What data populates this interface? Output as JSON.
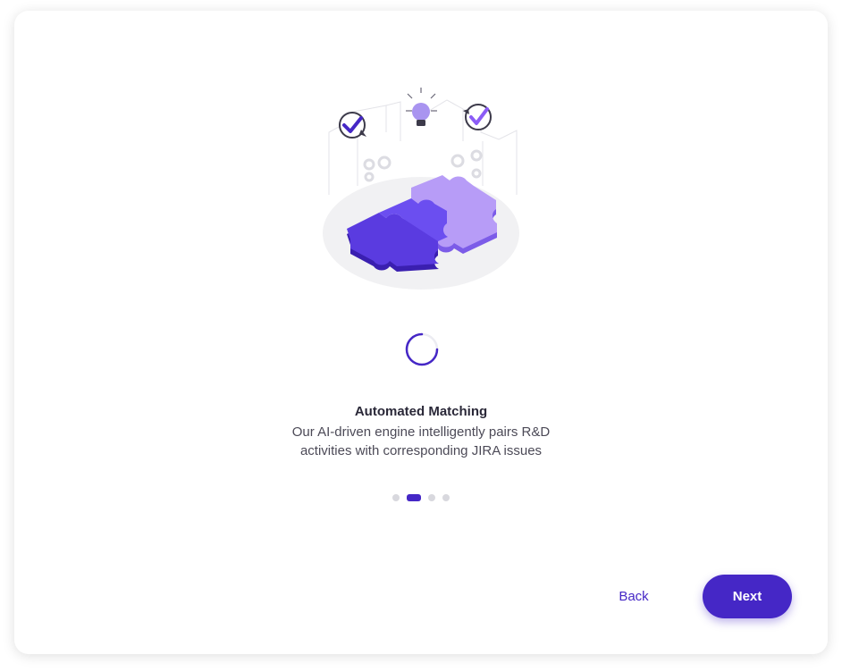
{
  "onboarding": {
    "title": "Automated Matching",
    "description_lines": [
      "Our AI-driven engine intelligently pairs R&D",
      "activities with corresponding JIRA issues"
    ],
    "steps_total": 4,
    "active_step": 2
  },
  "actions": {
    "back_label": "Back",
    "next_label": "Next"
  },
  "colors": {
    "accent": "#4527c6",
    "accent_light": "#8b5cf6",
    "dot_inactive": "#d8d8de"
  },
  "icons": [
    "puzzle-illustration",
    "lightbulb-icon",
    "check-icon",
    "gear-icon",
    "loading-spinner"
  ]
}
